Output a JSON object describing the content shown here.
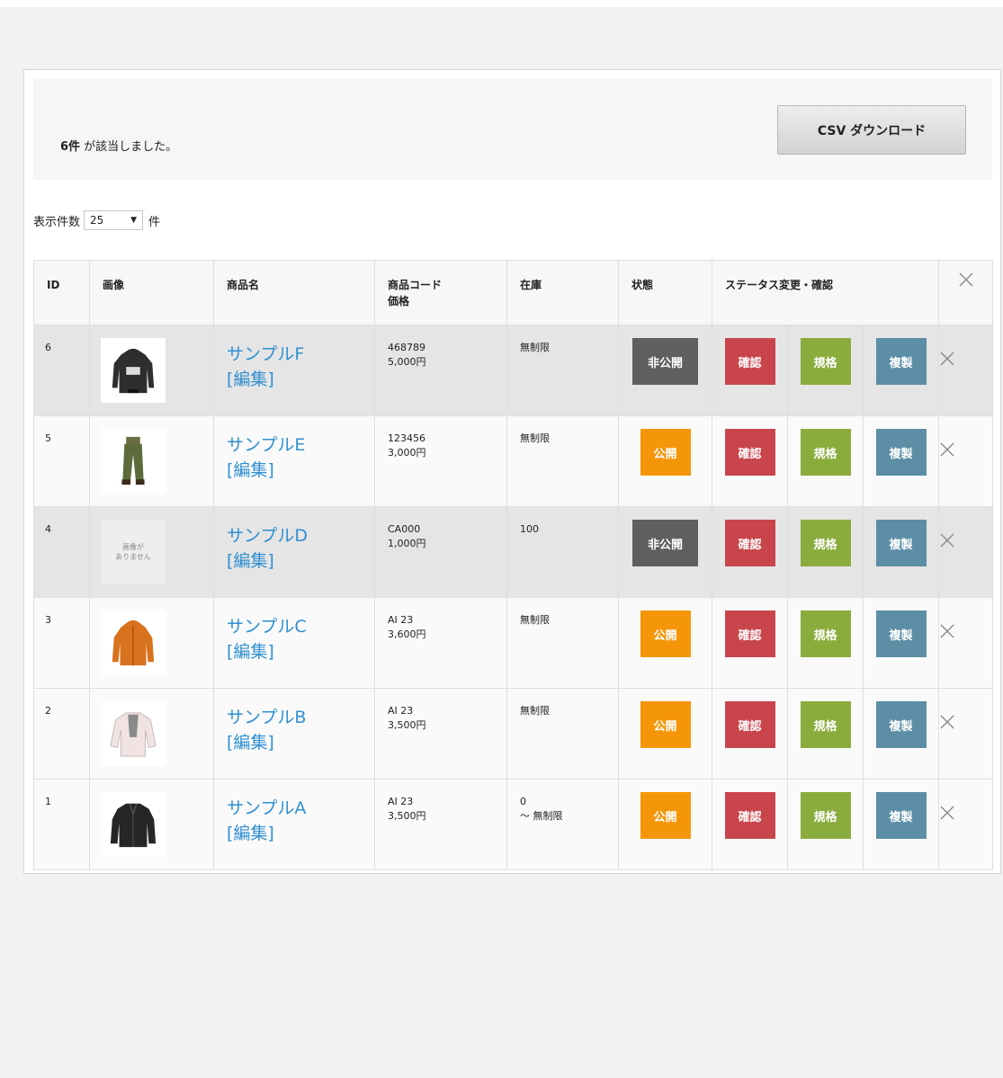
{
  "summary": {
    "count": "6件",
    "suffix": " が該当しました。"
  },
  "csv_button": "CSV ダウンロード",
  "pager": {
    "prefix": "表示件数",
    "value": "25",
    "suffix": "件"
  },
  "columns": [
    "ID",
    "画像",
    "商品名",
    "商品コード",
    "価格",
    "在庫",
    "状態",
    "ステータス変更・確認"
  ],
  "colors": {
    "private": "#5f5f5f",
    "public": "#f5960a",
    "confirm": "#c9454c",
    "spec": "#8aac3d",
    "copy": "#5c8ea6",
    "link": "#2f8fd0"
  },
  "labels": {
    "edit": "[編集]",
    "confirm": "確認",
    "spec": "規格",
    "copy": "複製",
    "no_image_1": "画像が",
    "no_image_2": "ありません"
  },
  "rows": [
    {
      "id": "6",
      "name": "サンプルF",
      "code": "468789",
      "price": "5,000円",
      "stock": "無制限",
      "stock2": "",
      "status": "非公開",
      "image": "hoodie"
    },
    {
      "id": "5",
      "name": "サンプルE",
      "code": "123456",
      "price": "3,000円",
      "stock": "無制限",
      "stock2": "",
      "status": "公開",
      "image": "pants"
    },
    {
      "id": "4",
      "name": "サンプルD",
      "code": "CA000",
      "price": "1,000円",
      "stock": "100",
      "stock2": "",
      "status": "非公開",
      "image": "none"
    },
    {
      "id": "3",
      "name": "サンプルC",
      "code": "AI 23",
      "price": "3,600円",
      "stock": "無制限",
      "stock2": "",
      "status": "公開",
      "image": "jacket-orange"
    },
    {
      "id": "2",
      "name": "サンプルB",
      "code": "AI 23",
      "price": "3,500円",
      "stock": "無制限",
      "stock2": "",
      "status": "公開",
      "image": "shirt-white"
    },
    {
      "id": "1",
      "name": "サンプルA",
      "code": "AI 23",
      "price": "3,500円",
      "stock": "0",
      "stock2": "～ 無制限",
      "status": "公開",
      "image": "jacket-black"
    }
  ]
}
